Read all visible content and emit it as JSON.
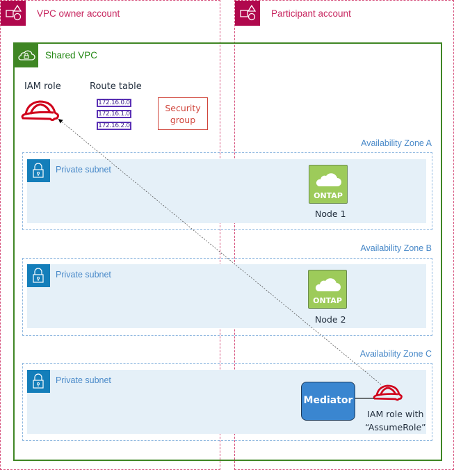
{
  "accounts": [
    {
      "label": "VPC owner account",
      "icon": "account-shapes-icon"
    },
    {
      "label": "Participant account",
      "icon": "account-shapes-icon"
    }
  ],
  "vpc": {
    "label": "Shared VPC",
    "icon": "cloud-lock-icon"
  },
  "owner_resources": {
    "iam_role_label": "IAM role",
    "route_table_label": "Route table",
    "routes": [
      "172.16.0.0",
      "172.16.1.0",
      "172.16.2.0"
    ],
    "security_group_lines": [
      "Security",
      "group"
    ]
  },
  "zones": [
    {
      "label": "Availability Zone A",
      "subnet_label": "Private subnet",
      "node": {
        "badge": "ONTAP",
        "label": "Node 1"
      }
    },
    {
      "label": "Availability Zone B",
      "subnet_label": "Private subnet",
      "node": {
        "badge": "ONTAP",
        "label": "Node 2"
      }
    },
    {
      "label": "Availability Zone C",
      "subnet_label": "Private subnet"
    }
  ],
  "mediator": {
    "label": "Mediator",
    "iam_role_lines": [
      "IAM role with",
      "“AssumeRole”"
    ]
  },
  "colors": {
    "account": "#b0084d",
    "vpc": "#3f8624",
    "subnet": "#147eba",
    "iam": "#d0021b",
    "ontap": "#9dcb5a",
    "mediator": "#3a86d0"
  }
}
